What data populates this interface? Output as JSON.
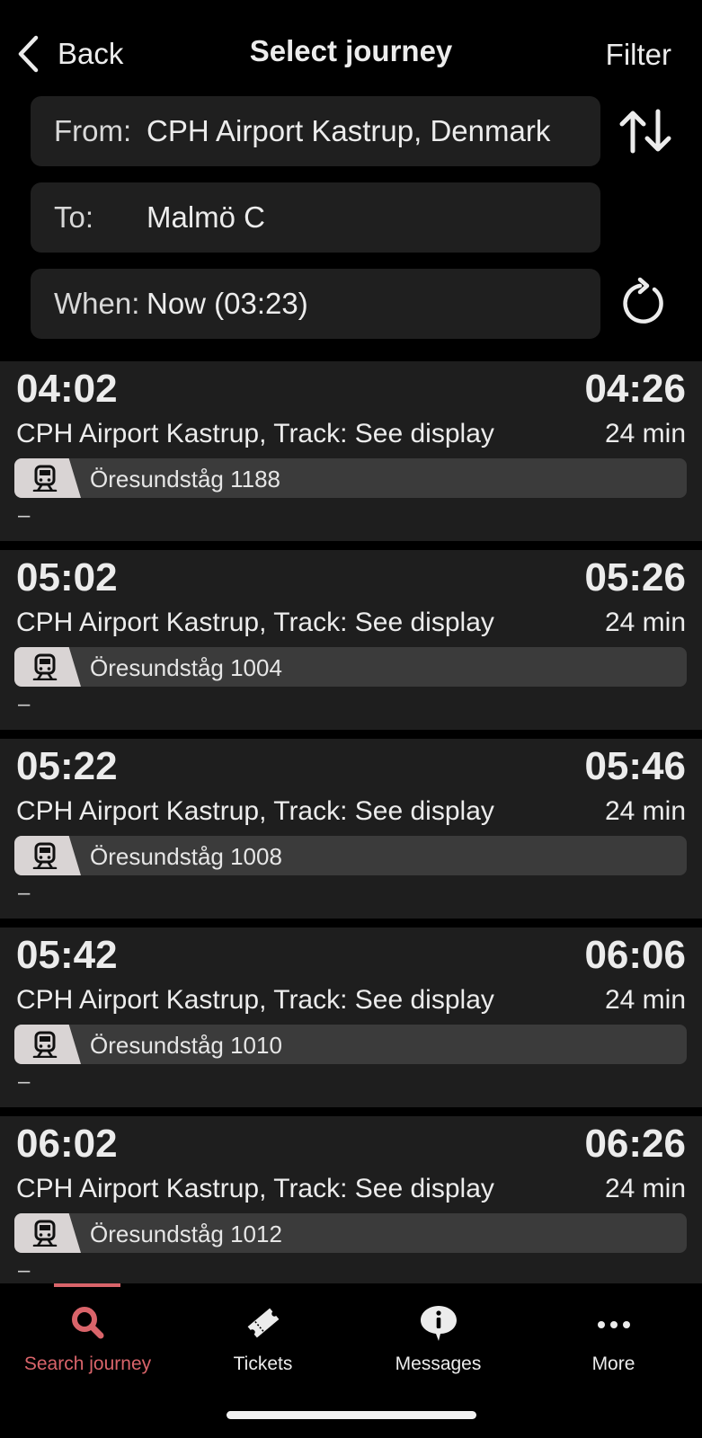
{
  "nav": {
    "back_label": "Back",
    "title": "Select journey",
    "filter_label": "Filter"
  },
  "search": {
    "from_label": "From:",
    "from_value": "CPH Airport Kastrup, Denmark",
    "to_label": "To:",
    "to_value": "Malmö C",
    "when_label": "When:",
    "when_value": "Now (03:23)"
  },
  "journeys": [
    {
      "dep": "04:02",
      "arr": "04:26",
      "stop": "CPH Airport Kastrup, Track: See display",
      "duration": "24 min",
      "line": "Öresundståg 1188",
      "note": "–"
    },
    {
      "dep": "05:02",
      "arr": "05:26",
      "stop": "CPH Airport Kastrup, Track: See display",
      "duration": "24 min",
      "line": "Öresundståg 1004",
      "note": "–"
    },
    {
      "dep": "05:22",
      "arr": "05:46",
      "stop": "CPH Airport Kastrup, Track: See display",
      "duration": "24 min",
      "line": "Öresundståg 1008",
      "note": "–"
    },
    {
      "dep": "05:42",
      "arr": "06:06",
      "stop": "CPH Airport Kastrup, Track: See display",
      "duration": "24 min",
      "line": "Öresundståg 1010",
      "note": "–"
    },
    {
      "dep": "06:02",
      "arr": "06:26",
      "stop": "CPH Airport Kastrup, Track: See display",
      "duration": "24 min",
      "line": "Öresundståg 1012",
      "note": "–"
    }
  ],
  "tabs": [
    {
      "label": "Search journey",
      "icon": "search-icon",
      "active": true
    },
    {
      "label": "Tickets",
      "icon": "ticket-icon",
      "active": false
    },
    {
      "label": "Messages",
      "icon": "message-icon",
      "active": false
    },
    {
      "label": "More",
      "icon": "more-icon",
      "active": false
    }
  ],
  "colors": {
    "accent": "#d9646a",
    "card_bg": "#1e1e1e",
    "field_bg": "#1f1f1f",
    "line_bg": "#3b3b3b",
    "badge_bg": "#d9d4d4"
  }
}
